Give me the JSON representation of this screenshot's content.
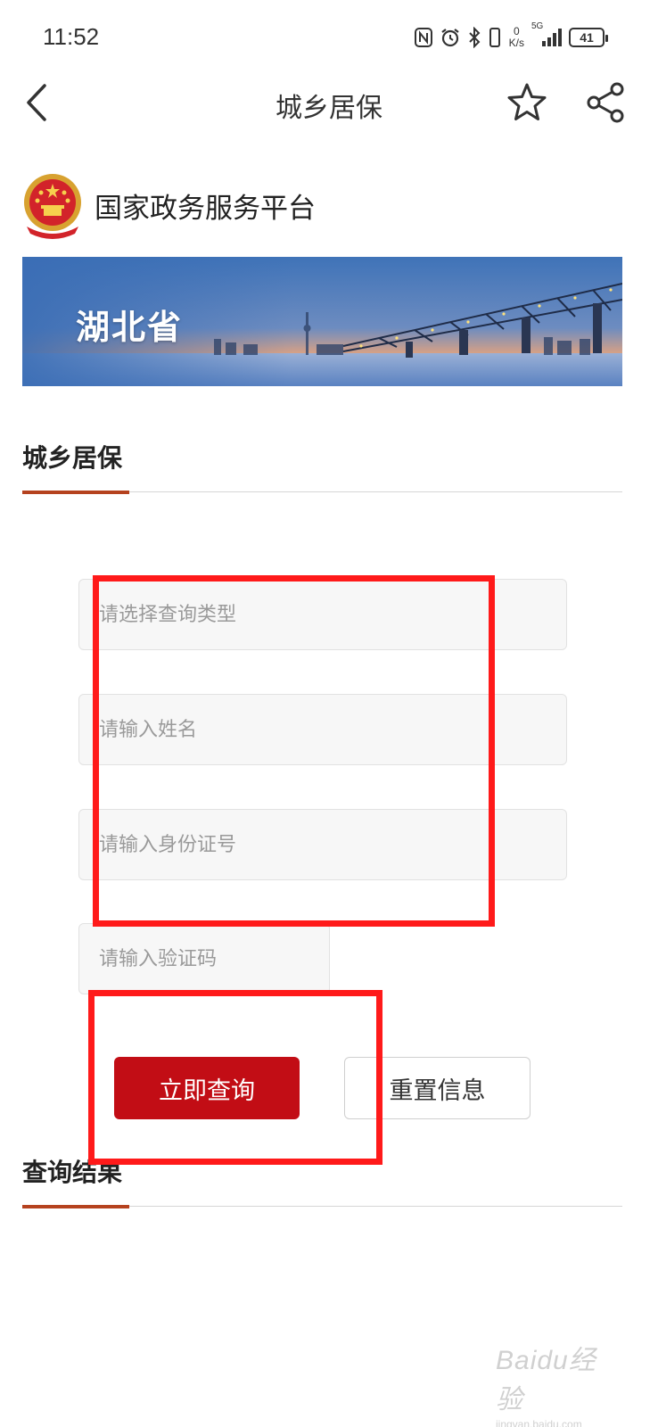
{
  "status_bar": {
    "time": "11:52",
    "net_speed_value": "0",
    "net_speed_unit": "K/s",
    "network": "5G",
    "battery": "41",
    "icons": [
      "nfc-icon",
      "alarm-icon",
      "bluetooth-icon",
      "vibrate-icon",
      "signal-icon",
      "battery-icon"
    ]
  },
  "nav": {
    "title": "城乡居保",
    "icons": [
      "back-arrow-icon",
      "star-icon",
      "share-icon"
    ]
  },
  "platform": {
    "name": "国家政务服务平台",
    "emblem_icon": "national-emblem-icon"
  },
  "banner": {
    "text": "湖北省"
  },
  "section_main": {
    "title": "城乡居保"
  },
  "form": {
    "query_type_placeholder": "请选择查询类型",
    "name_placeholder": "请输入姓名",
    "id_number_placeholder": "请输入身份证号",
    "captcha_placeholder": "请输入验证码",
    "submit_label": "立即查询",
    "reset_label": "重置信息"
  },
  "section_result": {
    "title": "查询结果"
  },
  "colors": {
    "primary_button": "#c20d15",
    "section_accent": "#b5421f",
    "annotation": "#ff1a1a"
  },
  "watermark": {
    "main": "Baidu经验",
    "sub": "jingyan.baidu.com"
  }
}
